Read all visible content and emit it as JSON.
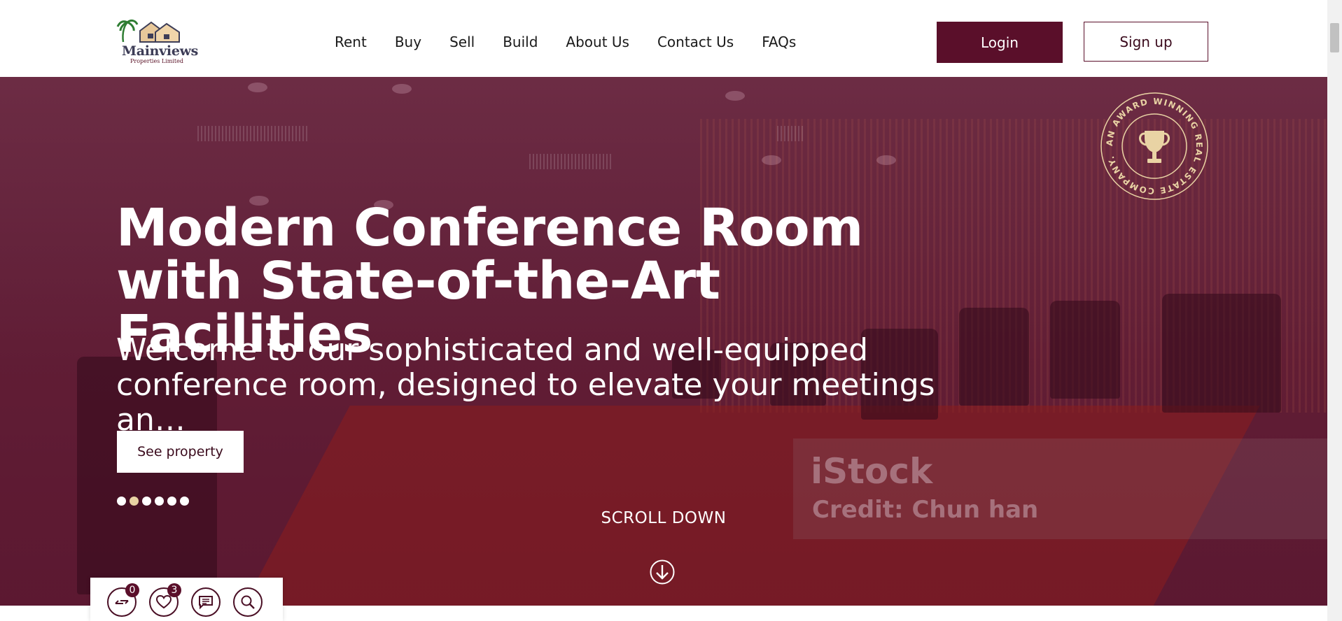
{
  "brand": {
    "name": "Mainviews",
    "subtitle": "Properties Limited"
  },
  "nav": {
    "items": [
      "Rent",
      "Buy",
      "Sell",
      "Build",
      "About Us",
      "Contact Us",
      "FAQs"
    ]
  },
  "auth": {
    "login_label": "Login",
    "signup_label": "Sign up"
  },
  "hero": {
    "title": "Modern Conference Room with State-of-the-Art Facilities",
    "subtitle": "Welcome to our sophisticated and well-equipped conference room, designed to elevate your meetings an…",
    "cta_label": "See property",
    "slides_count": 6,
    "active_slide": 2,
    "scroll_label": "SCROLL DOWN",
    "badge_text": "AN AWARD WINNING REAL ESTATE COMPANY.",
    "watermark_brand": "iStock",
    "watermark_credit": "Credit: Chun han"
  },
  "quick_actions": {
    "compare_count": "0",
    "favorites_count": "3"
  },
  "colors": {
    "brand": "#5a0f2a",
    "accent_dot": "#e9d3a4"
  },
  "icons": [
    "compare-icon",
    "heart-icon",
    "chat-icon",
    "search-icon",
    "trophy-icon",
    "arrow-down-icon"
  ]
}
